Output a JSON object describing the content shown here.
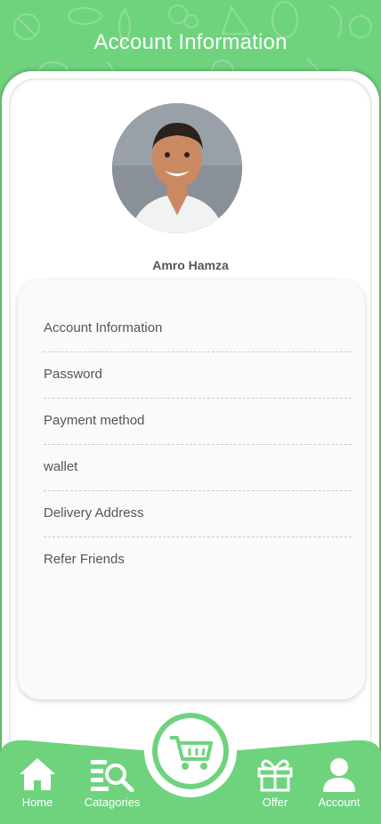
{
  "header": {
    "title": "Account Information"
  },
  "profile": {
    "name": "Amro Hamza"
  },
  "menu": {
    "items": [
      {
        "label": "Account Information"
      },
      {
        "label": "Password"
      },
      {
        "label": "Payment method"
      },
      {
        "label": "wallet"
      },
      {
        "label": "Delivery Address"
      },
      {
        "label": "Refer Friends"
      }
    ]
  },
  "nav": {
    "home": "Home",
    "categories": "Catagories",
    "offer": "Offer",
    "account": "Account"
  },
  "colors": {
    "brand_green": "#6fd37e",
    "panel": "#fafafa",
    "text": "#555555"
  },
  "icons": {
    "home": "home-icon",
    "categories": "category-search-icon",
    "cart": "cart-icon",
    "offer": "gift-icon",
    "account": "user-icon"
  }
}
